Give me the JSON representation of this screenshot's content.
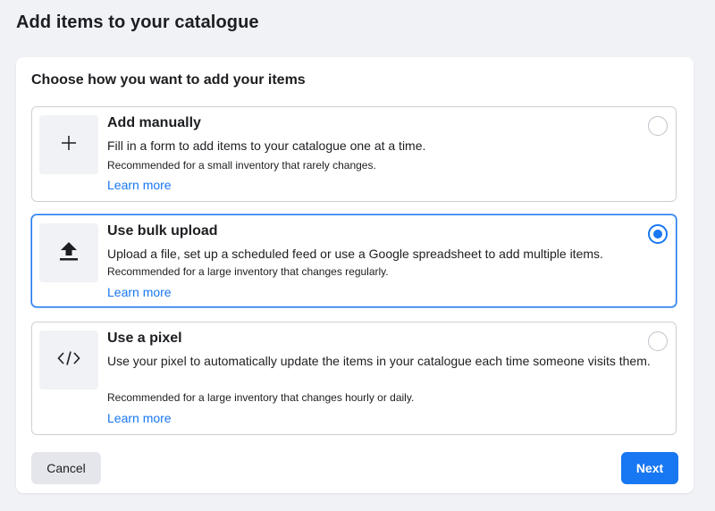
{
  "page": {
    "title": "Add items to your catalogue"
  },
  "card": {
    "heading": "Choose how you want to add your items"
  },
  "options": [
    {
      "title": "Add manually",
      "description": "Fill in a form to add items to your catalogue one at a time.",
      "recommendation": "Recommended for a small inventory that rarely changes.",
      "link": "Learn more",
      "icon": "plus-icon",
      "selected": false
    },
    {
      "title": "Use bulk upload",
      "description": "Upload a file, set up a scheduled feed or use a Google spreadsheet to add multiple items.",
      "recommendation": "Recommended for a large inventory that changes regularly.",
      "link": "Learn more",
      "icon": "upload-icon",
      "selected": true
    },
    {
      "title": "Use a pixel",
      "description": "Use your pixel to automatically update the items in your catalogue each time someone visits them.",
      "recommendation": "Recommended for a large inventory that changes hourly or daily.",
      "link": "Learn more",
      "icon": "code-icon",
      "selected": false
    }
  ],
  "actions": {
    "cancel_label": "Cancel",
    "next_label": "Next"
  },
  "colors": {
    "accent": "#1877f2",
    "background": "#f0f2f5",
    "border": "#ccd0d5"
  }
}
